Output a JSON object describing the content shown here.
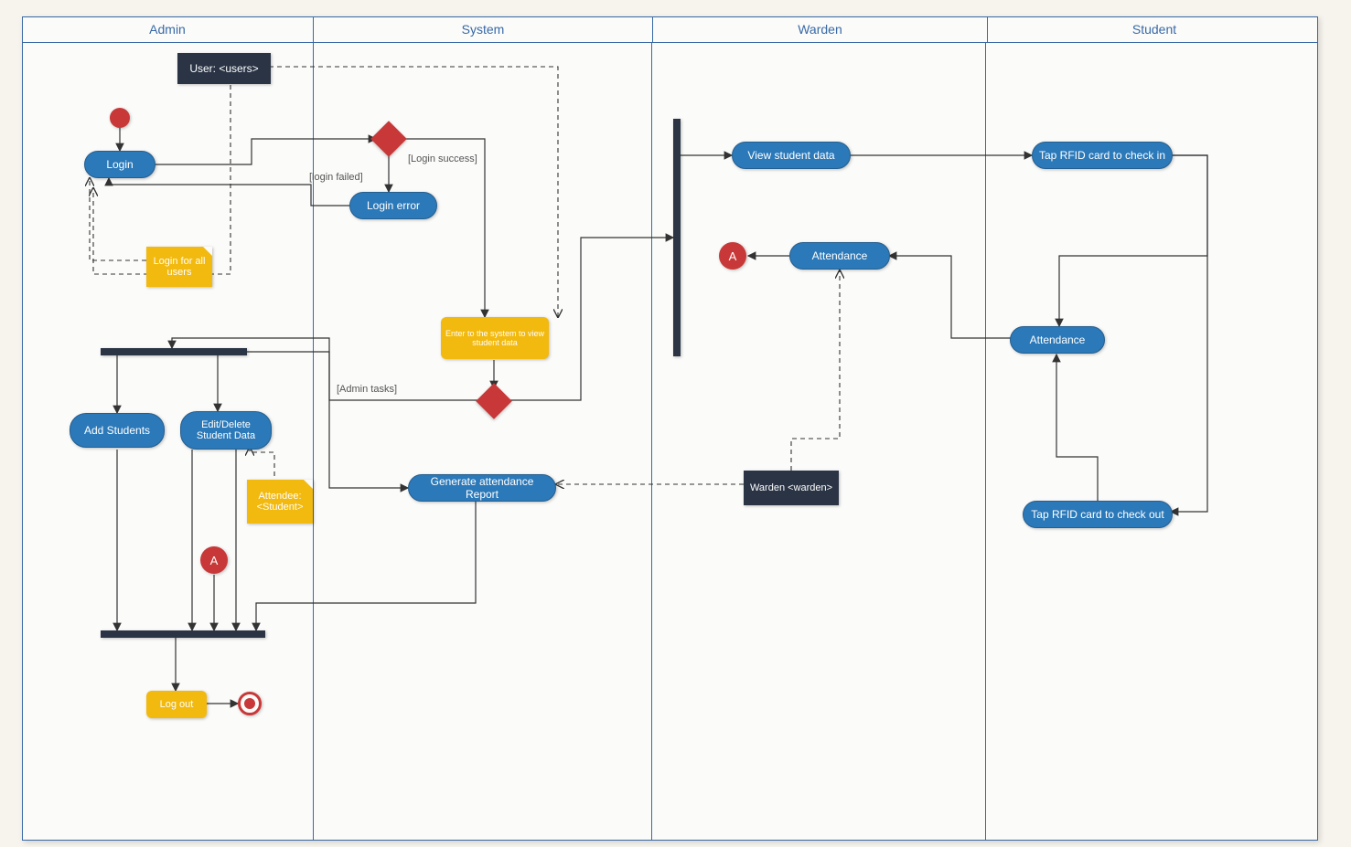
{
  "lanes": {
    "l0": "Admin",
    "l1": "System",
    "l2": "Warden",
    "l3": "Student"
  },
  "nodes": {
    "user_obj": "User: <users>",
    "login": "Login",
    "login_error": "Login error",
    "login_note": "Login for all users",
    "enter_system": "Enter to the system to view student data",
    "add_students": "Add Students",
    "edit_students": "Edit/Delete Student Data",
    "attendee_note": "Attendee: <Student>",
    "gen_report": "Generate attendance Report",
    "logout": "Log out",
    "view_student": "View student data",
    "attendance_w": "Attendance",
    "warden_obj": "Warden <warden>",
    "tap_in": "Tap RFID card to check in",
    "attendance_s": "Attendance",
    "tap_out": "Tap RFID card to check out",
    "conn_a1": "A",
    "conn_a2": "A"
  },
  "labels": {
    "login_failed": "[login failed]",
    "login_success": "[Login success]",
    "admin_tasks": "[Admin tasks]"
  }
}
